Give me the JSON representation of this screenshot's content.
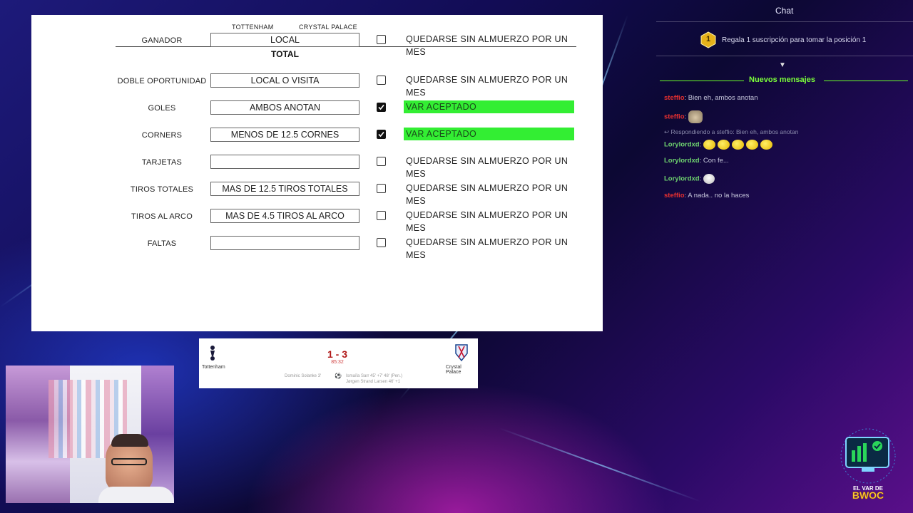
{
  "sheet": {
    "team_home": "TOTTENHAM",
    "team_away": "CRYSTAL PALACE",
    "total_label": "TOTAL",
    "rows": [
      {
        "label": "GANADOR",
        "value": "LOCAL",
        "checked": false,
        "result": "QUEDARSE SIN ALMUERZO POR UN MES",
        "green": false
      },
      {
        "label": "DOBLE OPORTUNIDAD",
        "value": "LOCAL O VISITA",
        "checked": false,
        "result": "QUEDARSE SIN ALMUERZO POR UN MES",
        "green": false
      },
      {
        "label": "GOLES",
        "value": "AMBOS ANOTAN",
        "checked": true,
        "result": "VAR ACEPTADO",
        "green": true
      },
      {
        "label": "CORNERS",
        "value": "MENOS DE 12.5 CORNES",
        "checked": true,
        "result": "VAR ACEPTADO",
        "green": true
      },
      {
        "label": "TARJETAS",
        "value": "",
        "checked": false,
        "result": "QUEDARSE SIN ALMUERZO POR UN MES",
        "green": false
      },
      {
        "label": "TIROS TOTALES",
        "value": "MAS DE 12.5 TIROS TOTALES",
        "checked": false,
        "result": "QUEDARSE SIN ALMUERZO POR UN MES",
        "green": false
      },
      {
        "label": "TIROS AL ARCO",
        "value": "MAS DE 4.5 TIROS AL ARCO",
        "checked": false,
        "result": "QUEDARSE SIN ALMUERZO POR UN MES",
        "green": false
      },
      {
        "label": "FALTAS",
        "value": "",
        "checked": false,
        "result": "QUEDARSE SIN ALMUERZO POR UN MES",
        "green": false
      }
    ]
  },
  "scorecard": {
    "home": "Tottenham",
    "away": "Crystal Palace",
    "score": "1 - 3",
    "time": "85:32",
    "home_scorers": "Dominic Solanke 3'",
    "away_scorers_1": "Ismaïla Sarr 45' +7' 48' (Pen.)",
    "away_scorers_2": "Jørgen Strand Larsen 46' +1",
    "colors": {
      "score": "#b01818"
    }
  },
  "chat": {
    "title": "Chat",
    "gift_rank": "1",
    "gift_text": "Regala 1 suscripción para tomar la posición 1",
    "new_messages": "Nuevos mensajes",
    "messages": [
      {
        "user": "steffio",
        "text": ": Bien eh, ambos anotan",
        "color": "#e83030"
      },
      {
        "user": "steffio",
        "text": ":",
        "color": "#e83030",
        "emote": "cat-emote"
      },
      {
        "user": "",
        "text": "↩ Respondiendo a steffio: Bien eh, ambos anotan",
        "color": "#888"
      },
      {
        "user": "Lorylordxd",
        "text": ":",
        "color": "#6fd36f",
        "emote": "yellow-emotes"
      },
      {
        "user": "Lorylordxd",
        "text": ": Con fe...",
        "color": "#6fd36f"
      },
      {
        "user": "Lorylordxd",
        "text": ":",
        "color": "#6fd36f",
        "emote": "duck-emote"
      },
      {
        "user": "steffio",
        "text": ": A nada.. no la haces",
        "color": "#e83030"
      }
    ]
  },
  "logo": {
    "line1": "EL VAR DE",
    "line2": "BWOC"
  }
}
